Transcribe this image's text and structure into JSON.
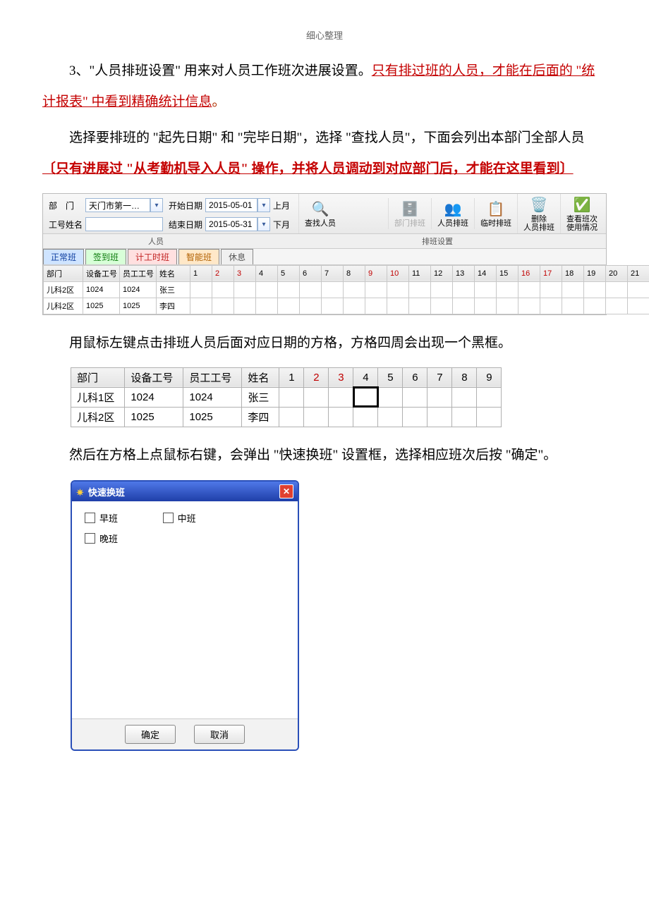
{
  "header_note": "细心整理",
  "para1": {
    "lead": "3、\"人员排班设置\" 用来对人员工作班次进展设置。",
    "red": "只有排过班的人员，才能在后面的 \"统计报表\" 中看到精确统计信息",
    "stop": "。"
  },
  "para2": {
    "a": "选择要排班的 \"起先日期\" 和 \"完毕日期\"，选择 \"查找人员\"，下面会列出本部门全部人员",
    "red": "〔只有进展过 \"从考勤机导入人员\" 操作，并将人员调动到对应部门后，才能在这里看到〕"
  },
  "toolbar": {
    "dept_label": "部　门",
    "dept_value": "天门市第一…",
    "emp_label": "工号姓名",
    "emp_value": "",
    "start_label": "开始日期",
    "start_value": "2015-05-01",
    "end_label": "结束日期",
    "end_value": "2015-05-31",
    "prev_month": "上月",
    "next_month": "下月",
    "search": "查找人员",
    "btn_dept": "部门排班",
    "btn_person": "人员排班",
    "btn_temp": "临时排班",
    "btn_del": "删除\n人员排班",
    "btn_view": "查看班次\n使用情况",
    "section_staff": "人员",
    "section_sched": "排班设置"
  },
  "shift_tabs": [
    "正常班",
    "签到班",
    "计工时班",
    "智能班",
    "休息"
  ],
  "grid": {
    "cols": [
      "部门",
      "设备工号",
      "员工工号",
      "姓名"
    ],
    "days": [
      "1",
      "2",
      "3",
      "4",
      "5",
      "6",
      "7",
      "8",
      "9",
      "10",
      "11",
      "12",
      "13",
      "14",
      "15",
      "16",
      "17",
      "18",
      "19",
      "20",
      "21"
    ],
    "red_days": [
      2,
      3,
      9,
      10,
      16,
      17
    ],
    "rows": [
      {
        "dept": "儿科2区",
        "dev": "1024",
        "emp": "1024",
        "name": "张三"
      },
      {
        "dept": "儿科2区",
        "dev": "1025",
        "emp": "1025",
        "name": "李四"
      }
    ]
  },
  "para3": "用鼠标左键点击排班人员后面对应日期的方格，方格四周会出现一个黑框。",
  "mini": {
    "cols": [
      "部门",
      "设备工号",
      "员工工号",
      "姓名"
    ],
    "days": [
      "1",
      "2",
      "3",
      "4",
      "5",
      "6",
      "7",
      "8",
      "9"
    ],
    "red_days": [
      2,
      3
    ],
    "rows": [
      {
        "dept": "儿科1区",
        "dev": "1024",
        "emp": "1024",
        "name": "张三",
        "sel_day": 4
      },
      {
        "dept": "儿科2区",
        "dev": "1025",
        "emp": "1025",
        "name": "李四",
        "sel_day": null
      }
    ]
  },
  "para4": "然后在方格上点鼠标右键，会弹出 \"快速换班\" 设置框，选择相应班次后按 \"确定\"。",
  "dialog": {
    "title": "快速换班",
    "options": [
      "早班",
      "中班",
      "晚班"
    ],
    "ok": "确定",
    "cancel": "取消"
  }
}
